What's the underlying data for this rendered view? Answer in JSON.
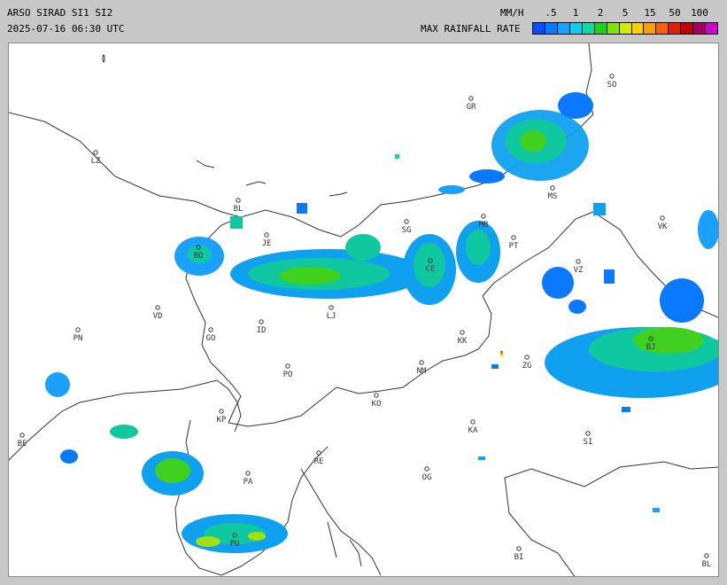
{
  "header": {
    "title_line1": "ARSO SIRAD SI1 SI2",
    "title_line2": "2025-07-16 06:30 UTC",
    "units": "MM/H",
    "scale_title": "MAX RAINFALL RATE"
  },
  "legend": {
    "ticks": [
      ".5",
      "1",
      "2",
      "5",
      "15",
      "50",
      "100"
    ],
    "colors": [
      "#0050ff",
      "#0a78ff",
      "#1aa0ff",
      "#10c8f0",
      "#10d8a0",
      "#20d020",
      "#80e010",
      "#d8e800",
      "#f8d000",
      "#f8a000",
      "#f86000",
      "#e02000",
      "#c00000",
      "#a00060",
      "#d000d0"
    ]
  },
  "map": {
    "cities": [
      {
        "code": "SO"
      },
      {
        "code": "GR"
      },
      {
        "code": "LZ"
      },
      {
        "code": "BL"
      },
      {
        "code": "JE"
      },
      {
        "code": "SG"
      },
      {
        "code": "MB"
      },
      {
        "code": "MS"
      },
      {
        "code": "VK"
      },
      {
        "code": "BO"
      },
      {
        "code": "PT"
      },
      {
        "code": "CE"
      },
      {
        "code": "VZ"
      },
      {
        "code": "VD"
      },
      {
        "code": "LJ"
      },
      {
        "code": "BJ"
      },
      {
        "code": "PN"
      },
      {
        "code": "GO"
      },
      {
        "code": "ID"
      },
      {
        "code": "KK"
      },
      {
        "code": "ZG"
      },
      {
        "code": "PO"
      },
      {
        "code": "NM"
      },
      {
        "code": "KO"
      },
      {
        "code": "KP"
      },
      {
        "code": "BE"
      },
      {
        "code": "KA"
      },
      {
        "code": "SI"
      },
      {
        "code": "RE"
      },
      {
        "code": "OG"
      },
      {
        "code": "PA"
      },
      {
        "code": "PU"
      },
      {
        "code": "BI"
      },
      {
        "code": "BL"
      }
    ]
  }
}
